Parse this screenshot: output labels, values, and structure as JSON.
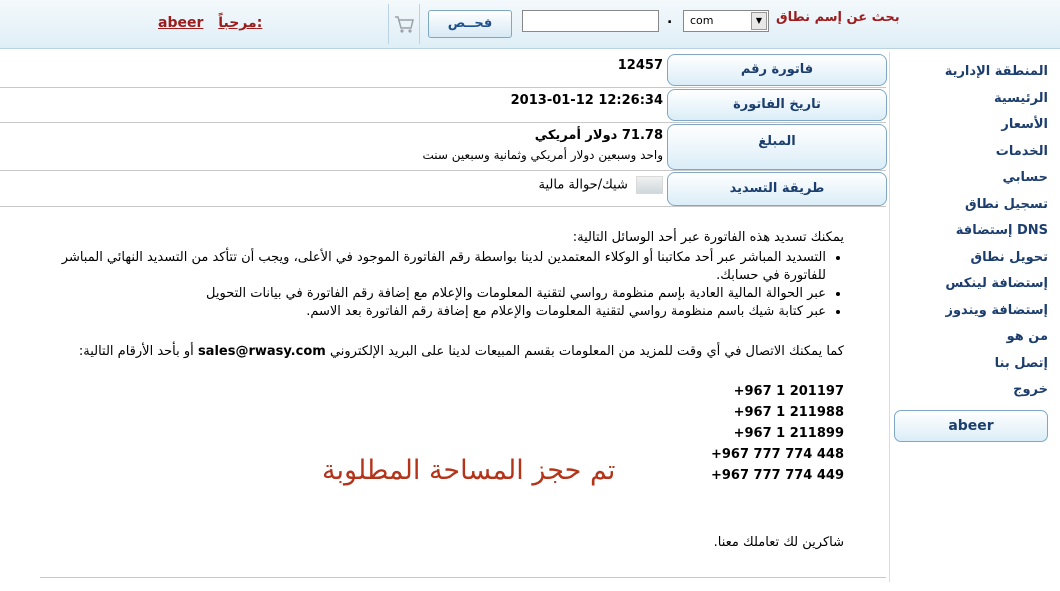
{
  "header": {
    "welcome_label": "مرحباً:",
    "username": "abeer",
    "check_button": "فحــص",
    "domain_input_value": "",
    "tld_selected": "com",
    "search_label": "بحث عن إسم نطاق"
  },
  "sidebar": {
    "items": [
      {
        "label": "المنطقة الإدارية"
      },
      {
        "label": "الرئيسية"
      },
      {
        "label": "الأسعار"
      },
      {
        "label": "الخدمات"
      },
      {
        "label": "حسابي"
      },
      {
        "label": "تسجيل نطاق"
      },
      {
        "label": "إستضافة DNS"
      },
      {
        "label": "تحويل نطاق"
      },
      {
        "label": "إستضافة لينكس"
      },
      {
        "label": "إستضافة ويندوز"
      },
      {
        "label": "من هو"
      },
      {
        "label": "إتصل بنا"
      },
      {
        "label": "خروج"
      }
    ],
    "user": "abeer"
  },
  "invoice": {
    "number_label": "فاتورة رقم",
    "number": "12457",
    "date_label": "تاريخ الفاتورة",
    "date": "2013-01-12 12:26:34",
    "amount_label": "المبلغ",
    "amount": "71.78 دولار أمريكي",
    "amount_words": "واحد وسبعين دولار أمريكي وثمانية وسبعين سنت",
    "payment_label": "طريقة التسديد",
    "payment_method": "شيك/حوالة مالية"
  },
  "body": {
    "intro": "يمكنك تسديد هذه الفاتورة عبر أحد الوسائل التالية:",
    "bullets": [
      "التسديد المباشر عبر أحد مكاتبنا أو الوكلاء المعتمدين لدينا بواسطة رقم الفاتورة الموجود في الأعلى، ويجب أن تتأكد من التسديد النهائي المباشر للفاتورة في حسابك.",
      "عبر الحوالة المالية العادية بإسم منظومة رواسي لتقنية المعلومات والإعلام مع إضافة رقم الفاتورة في بيانات التحويل",
      "عبر كتابة شيك باسم منظومة رواسي لتقنية المعلومات والإعلام مع إضافة رقم الفاتورة بعد الاسم."
    ],
    "contact_prefix": "كما يمكنك الاتصال في أي وقت للمزيد من المعلومات بقسم المبيعات لدينا على البريد الإلكتروني",
    "email": "sales@rwasy.com",
    "contact_suffix": "أو بأحد الأرقام التالية:",
    "phones": [
      "+967 1 201197",
      "+967 1 211988",
      "+967 1 211899",
      "+967 777 774 448",
      "+967 777 774 449"
    ],
    "thanks": "شاكرين لك تعاملك معنا.",
    "stamp": "تم حجز المساحة المطلوبة"
  },
  "colors": {
    "accent_text": "#1c3e6e",
    "header_red": "#9b1c1c",
    "stamp_red": "#b4341a"
  }
}
